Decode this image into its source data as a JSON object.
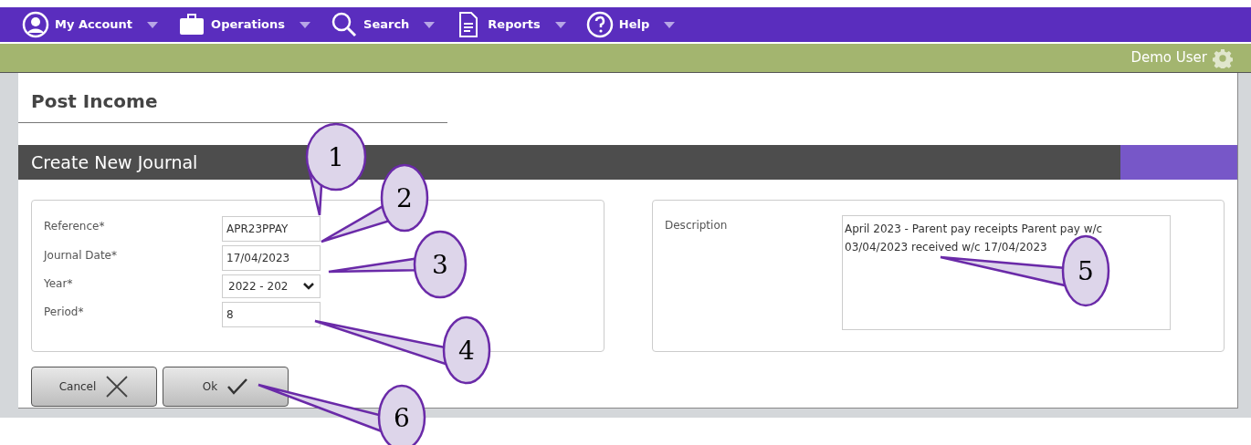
{
  "nav": [
    {
      "label": "My Account",
      "kind": "user"
    },
    {
      "label": "Operations",
      "kind": "briefcase"
    },
    {
      "label": "Search",
      "kind": "search"
    },
    {
      "label": "Reports",
      "kind": "document"
    },
    {
      "label": "Help",
      "kind": "help"
    }
  ],
  "user": "Demo User",
  "page_title": "Post Income",
  "section_title": "Create New Journal",
  "fields": [
    {
      "label": "Reference*",
      "kind": "text",
      "value": "APR23PPAY"
    },
    {
      "label": "Journal Date*",
      "kind": "text",
      "value": "17/04/2023"
    },
    {
      "label": "Year*",
      "kind": "select",
      "value": "2022 - 202"
    },
    {
      "label": "Period*",
      "kind": "text",
      "value": "8"
    }
  ],
  "description": {
    "label": "Description",
    "value": "April 2023 - Parent pay receipts Parent pay w/c 03/04/2023 received w/c 17/04/2023"
  },
  "buttons": [
    {
      "label": "Cancel",
      "kind": "cancel"
    },
    {
      "label": "Ok",
      "kind": "confirm"
    }
  ],
  "callouts": [
    "1",
    "2",
    "3",
    "4",
    "5",
    "6"
  ]
}
